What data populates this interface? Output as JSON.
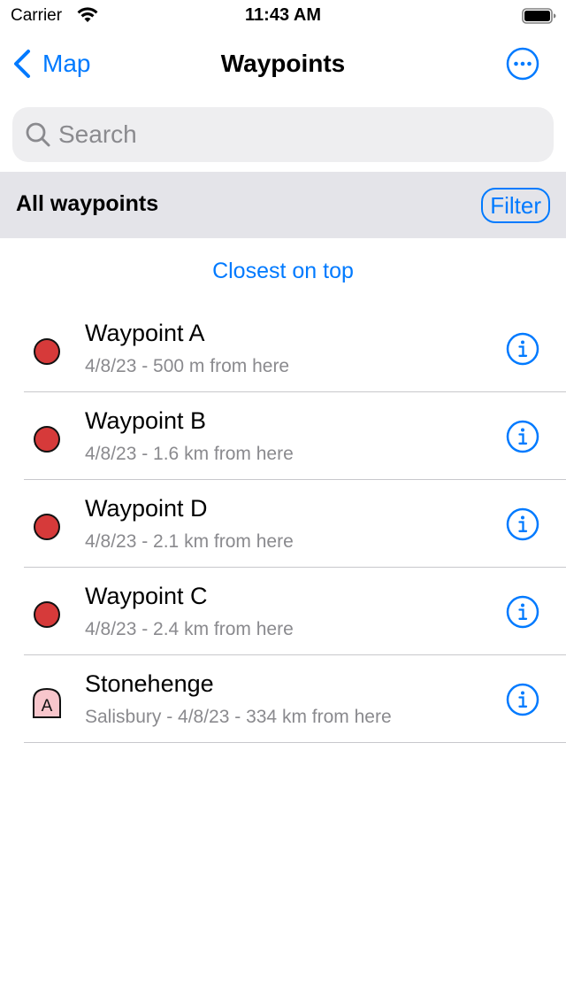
{
  "status_bar": {
    "carrier": "Carrier",
    "time": "11:43 AM"
  },
  "nav": {
    "back_label": "Map",
    "title": "Waypoints"
  },
  "search": {
    "placeholder": "Search",
    "value": ""
  },
  "section": {
    "title": "All waypoints",
    "filter_label": "Filter"
  },
  "sort": {
    "label": "Closest on top"
  },
  "waypoints": [
    {
      "title": "Waypoint A",
      "subtitle": "4/8/23 - 500 m from here",
      "icon": "red-dot-icon"
    },
    {
      "title": "Waypoint B",
      "subtitle": "4/8/23 - 1.6 km from here",
      "icon": "red-dot-icon"
    },
    {
      "title": "Waypoint D",
      "subtitle": "4/8/23 - 2.1 km from here",
      "icon": "red-dot-icon"
    },
    {
      "title": "Waypoint C",
      "subtitle": "4/8/23 - 2.4 km from here",
      "icon": "red-dot-icon"
    },
    {
      "title": "Stonehenge",
      "subtitle": "Salisbury - 4/8/23 - 334 km from here",
      "icon": "landmark-a-icon",
      "icon_letter": "A"
    }
  ],
  "colors": {
    "accent": "#007aff",
    "pin_red": "#d63a3a",
    "landmark_pink": "#f8c6cc",
    "section_bg": "#e4e4e9",
    "secondary_text": "#8a8a8e"
  }
}
